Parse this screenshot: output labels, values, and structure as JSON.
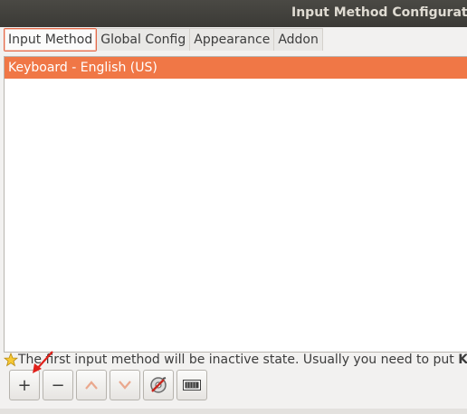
{
  "window": {
    "title": "Input Method Configuration"
  },
  "tabs": [
    {
      "label": "Input Method",
      "active": true
    },
    {
      "label": "Global Config",
      "active": false
    },
    {
      "label": "Appearance",
      "active": false
    },
    {
      "label": "Addon",
      "active": false
    }
  ],
  "input_methods": {
    "items": [
      {
        "label": "Keyboard - English (US)",
        "selected": true
      }
    ]
  },
  "hint": {
    "icon": "star-icon",
    "text": "The first input method will be inactive state. Usually you need to put ",
    "bold_text": "Keyboard"
  },
  "toolbar": {
    "add_label": "+",
    "remove_label": "−",
    "move_up_icon": "chevron-up-icon",
    "move_down_icon": "chevron-down-icon",
    "configure_icon": "settings-tool-icon",
    "keyboard_layout_icon": "keyboard-icon"
  },
  "annotation": {
    "arrow_color": "#e0201a"
  },
  "colors": {
    "selection": "#f07746",
    "active_tab_border": "#e46a4a",
    "titlebar": "#3b3a36"
  }
}
